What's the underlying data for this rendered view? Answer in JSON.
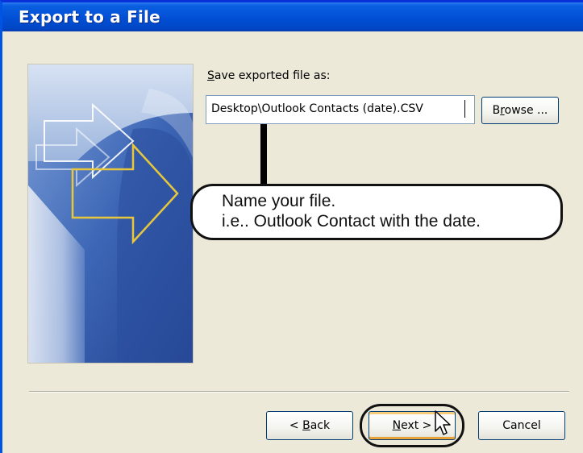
{
  "window": {
    "title": "Export to a File"
  },
  "form": {
    "save_label_mnemonic": "S",
    "save_label_rest": "ave exported file as:",
    "file_path_value": "Desktop\\Outlook Contacts (date).CSV",
    "browse_mnemonic": "r",
    "browse_prefix": "B",
    "browse_suffix": "owse ..."
  },
  "callout": {
    "line1": "Name your file.",
    "line2": "i.e.. Outlook Contact with the date."
  },
  "buttons": {
    "back_prefix": "< ",
    "back_mnemonic": "B",
    "back_suffix": "ack",
    "next_mnemonic": "N",
    "next_suffix": "ext >",
    "cancel_label": "Cancel"
  },
  "colors": {
    "titlebar": "#0250d6",
    "dialog_bg": "#ece9d8",
    "graphic_blue": "#3762b0",
    "arrow_accent": "#e8c83a"
  },
  "icons": {
    "cursor": "arrow-pointer-icon"
  }
}
